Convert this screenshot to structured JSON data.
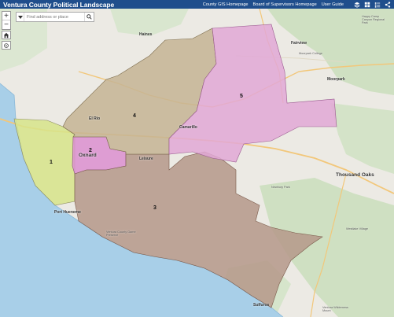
{
  "header": {
    "title": "Ventura County Political Landscape",
    "links": [
      "County GIS Homepage",
      "Board of Supervisors Homepage",
      "User Guide"
    ]
  },
  "search": {
    "placeholder": "Find address or place"
  },
  "zoom": {
    "in_label": "+",
    "out_label": "−"
  },
  "districts": [
    {
      "label": "1",
      "color": "#d7e48a"
    },
    {
      "label": "2",
      "color": "#dc8fd0"
    },
    {
      "label": "3",
      "color": "#b5988a"
    },
    {
      "label": "4",
      "color": "#c6b494"
    },
    {
      "label": "5",
      "color": "#e2a8d6"
    }
  ],
  "places": {
    "oxnard": "Oxnard",
    "camarillo": "Camarillo",
    "el_rio": "El Rio",
    "leisure": "Leisure",
    "thousand_oaks": "Thousand Oaks",
    "moorpark": "Moorpark",
    "fairview": "Fairview",
    "haines": "Haines",
    "port_hueneme": "Port Hueneme",
    "sulfur": "Sulfuros",
    "newbury_park": "Newbury Park",
    "westlake": "Westlake Village",
    "moorpark_college": "Moorpark College",
    "happy_camp": "Happy Camp Canyon Regional Park",
    "hidden_pond": "Ventura County Game Preserve",
    "ventura_wmt": "Ventura Wilderness Mount"
  },
  "colors": {
    "header": "#1f4e8c",
    "ocean": "#a8cfe8",
    "land": "#eceae4"
  }
}
